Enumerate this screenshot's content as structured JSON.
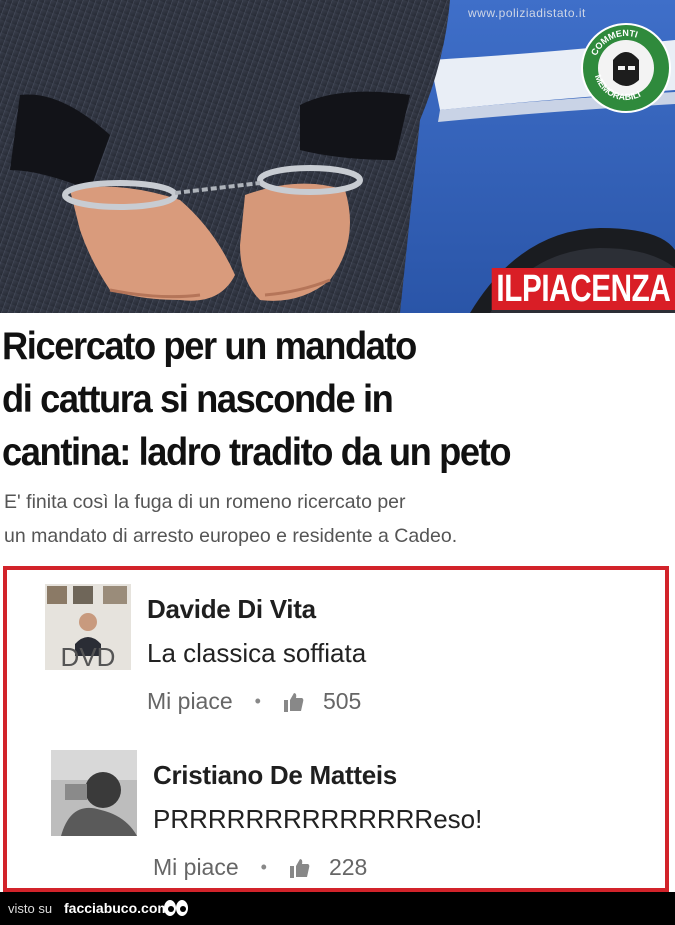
{
  "photo": {
    "watermark_url": "www.poliziadistato.it",
    "badge_text_top": "COMMENTI",
    "badge_text_bottom": "MEMORABILI",
    "brand_prefix": "IL",
    "brand_name": "PIACENZA"
  },
  "article": {
    "headline_line1": "Ricercato per un mandato",
    "headline_line2": "di cattura si nasconde in",
    "headline_line3": "cantina: ladro tradito da un peto",
    "subtitle_line1": "E' finita così la fuga di un romeno ricercato per",
    "subtitle_line2": "un mandato di arresto europeo e residente a Cadeo."
  },
  "comments": [
    {
      "author": "Davide Di Vita",
      "text": "La classica soffiata",
      "like_label": "Mi piace",
      "likes": "505",
      "avatar_letters": "DVD"
    },
    {
      "author": "Cristiano De Matteis",
      "text": "PRRRRRRRRRRRRRReso!",
      "like_label": "Mi piace",
      "likes": "228"
    }
  ],
  "footer": {
    "visto_su": "visto su",
    "site": "facciabuco.com"
  },
  "colors": {
    "brand_red": "#d91e26",
    "frame_red": "#d2232a",
    "badge_green": "#2f8a3c"
  }
}
